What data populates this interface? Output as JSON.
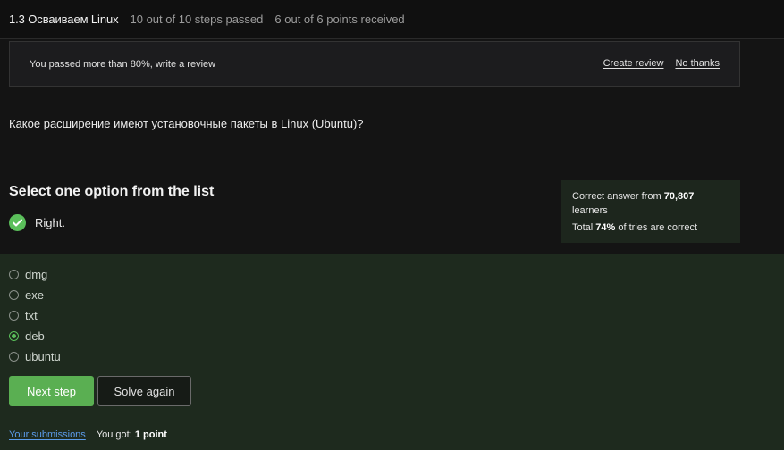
{
  "header": {
    "lesson": "1.3 Осваиваем Linux",
    "steps": "10 out of 10 steps passed",
    "points": "6 out of 6 points  received"
  },
  "review_banner": {
    "message": "You passed more than 80%, write a review",
    "create_label": "Create review",
    "decline_label": "No thanks"
  },
  "question": "Какое расширение имеют установочные пакеты в Linux (Ubuntu)?",
  "quiz": {
    "title": "Select one option from the list",
    "result": "Right.",
    "stats": {
      "prefix1": "Correct answer from ",
      "learners_count": "70,807",
      "suffix1": " learners",
      "prefix2": "Total ",
      "percent": "74%",
      "suffix2": " of tries are correct"
    },
    "options": [
      {
        "label": "dmg",
        "checked": false
      },
      {
        "label": "exe",
        "checked": false
      },
      {
        "label": "txt",
        "checked": false
      },
      {
        "label": "deb",
        "checked": true
      },
      {
        "label": "ubuntu",
        "checked": false
      }
    ],
    "next_label": "Next step",
    "solve_again_label": "Solve again",
    "submissions_label": "Your submissions",
    "got_prefix": "You got: ",
    "got_value": "1 point"
  },
  "colors": {
    "accent_green": "#5aaf52",
    "link_blue": "#5b9bea",
    "panel_green": "#1e2a1e"
  }
}
